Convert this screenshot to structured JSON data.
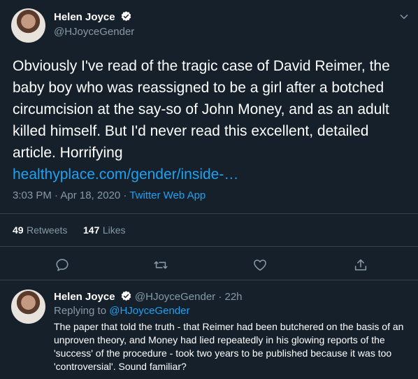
{
  "main_tweet": {
    "author_name": "Helen Joyce",
    "author_handle": "@HJoyceGender",
    "text": "Obviously I've read of the tragic case of David Reimer, the baby boy who was reassigned to be a girl after a botched circumcision at the say-so of John Money, and as an adult killed himself. But I'd never read this excellent, detailed article. Horrifying",
    "link": "healthyplace.com/gender/inside-…",
    "time": "3:03 PM · Apr 18, 2020 · ",
    "source": "Twitter Web App",
    "retweets_count": "49",
    "retweets_label": "Retweets",
    "likes_count": "147",
    "likes_label": "Likes"
  },
  "reply": {
    "author_name": "Helen Joyce",
    "author_handle": "@HJoyceGender · 22h",
    "replying_prefix": "Replying to ",
    "replying_to": "@HJoyceGender",
    "text": "The paper that told the truth - that Reimer had been butchered on the basis of an unproven theory, and Money had lied repeatedly in his glowing reports of the 'success' of the procedure - took two years to be published because it was too 'controversial'. Sound familiar?"
  },
  "icons": {
    "verified": "verified-badge-icon",
    "more": "chevron-down-icon",
    "reply": "reply-icon",
    "retweet": "retweet-icon",
    "like": "heart-icon",
    "share": "share-icon"
  },
  "colors": {
    "background": "#15202b",
    "accent": "#1da1f2",
    "muted": "#8899a6",
    "divider": "#38444d"
  }
}
